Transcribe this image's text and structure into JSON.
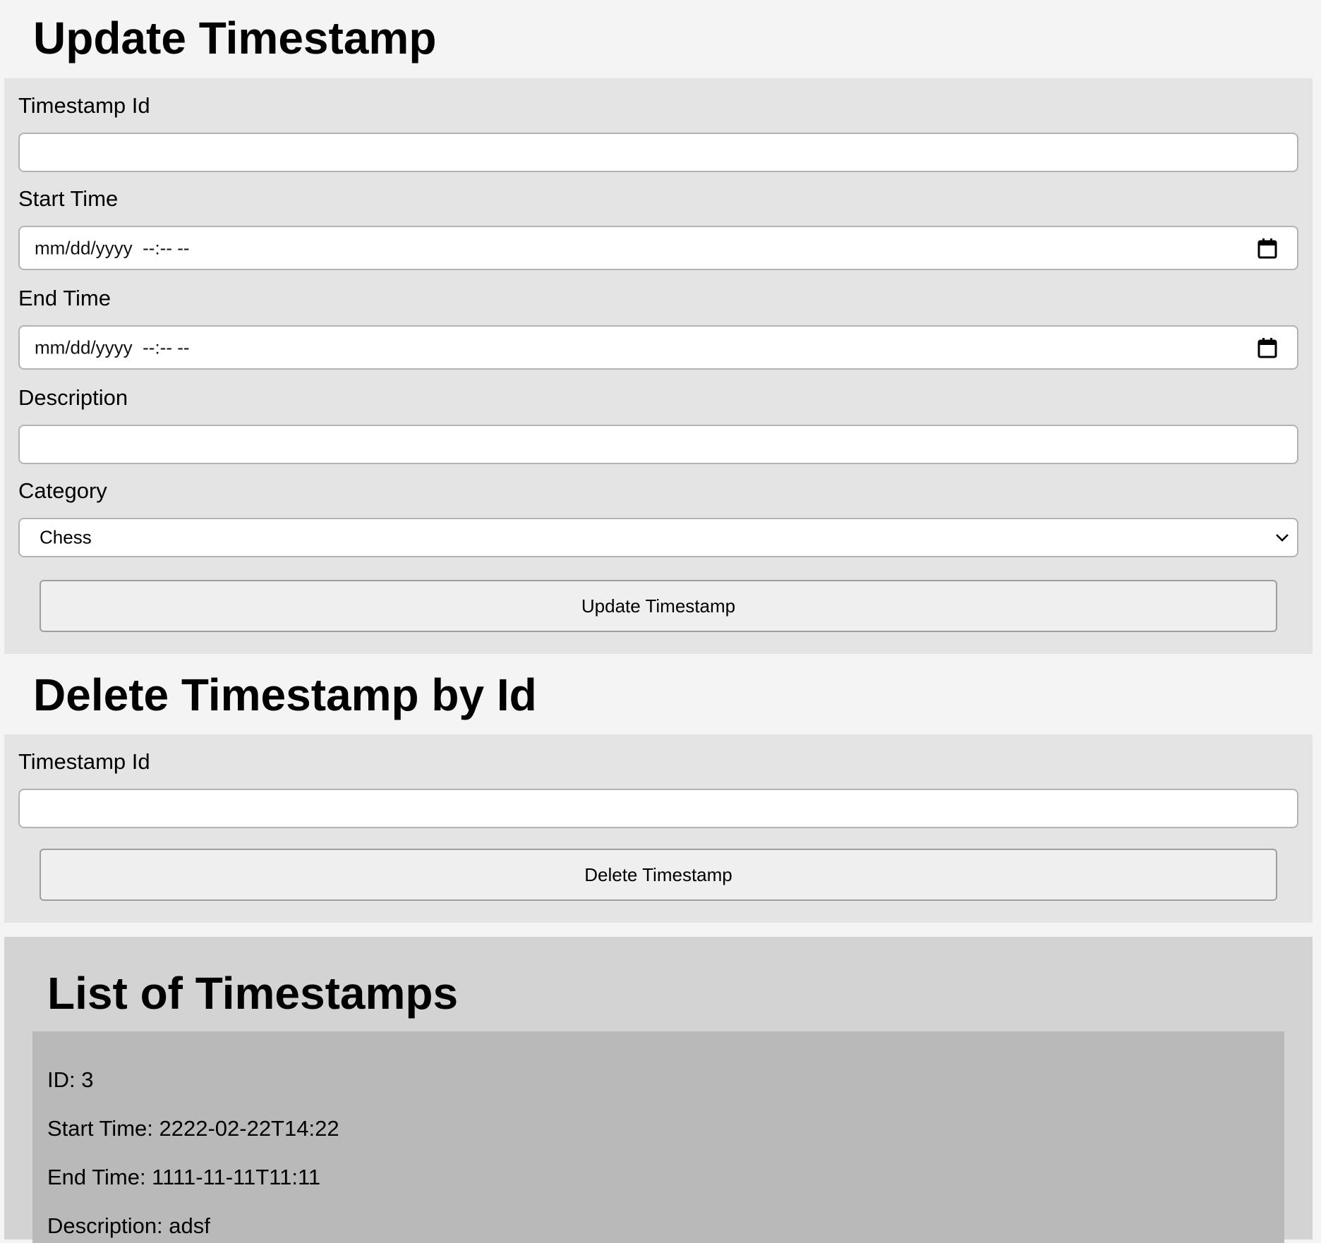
{
  "update_section": {
    "title": "Update Timestamp",
    "labels": {
      "timestamp_id": "Timestamp Id",
      "start_time": "Start Time",
      "end_time": "End Time",
      "description": "Description",
      "category": "Category"
    },
    "timestamp_id_value": "",
    "start_time_placeholder": "mm/dd/yyyy  --:-- --",
    "end_time_placeholder": "mm/dd/yyyy  --:-- --",
    "description_value": "",
    "category_selected": "Chess",
    "submit_label": "Update Timestamp"
  },
  "delete_section": {
    "title": "Delete Timestamp by Id",
    "label_timestamp_id": "Timestamp Id",
    "timestamp_id_value": "",
    "submit_label": "Delete Timestamp"
  },
  "list_section": {
    "title": "List of Timestamps",
    "items": [
      {
        "id_line": "ID: 3",
        "start_line": "Start Time: 2222-02-22T14:22",
        "end_line": "End Time: 1111-11-11T11:11",
        "description_line": "Description: adsf"
      }
    ]
  },
  "icons": {
    "calendar": "calendar-icon",
    "chevron": "chevron-down-icon"
  }
}
